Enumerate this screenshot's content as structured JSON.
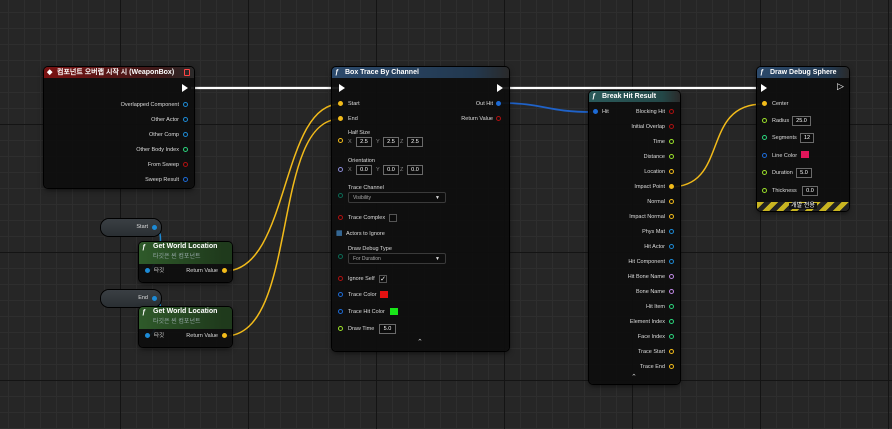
{
  "wire_colors": {
    "exec": "#ffffff",
    "struct": "#1d6bd6",
    "vector": "#f2bb1a",
    "object": "#1d8bd6"
  },
  "event_node": {
    "title": "컴포넌트 오버랩 시작 시 (WeaponBox)",
    "pins": [
      "Overlapped Component",
      "Other Actor",
      "Other Comp",
      "Other Body Index",
      "From Sweep",
      "Sweep Result"
    ]
  },
  "var_start": {
    "label": "Start"
  },
  "var_end": {
    "label": "End"
  },
  "gwl1": {
    "title": "Get World Location",
    "subtitle": "타깃은 씬 컴포넌트",
    "target": "타깃",
    "return": "Return Value"
  },
  "gwl2": {
    "title": "Get World Location",
    "subtitle": "타깃은 씬 컴포넌트",
    "target": "타깃",
    "return": "Return Value"
  },
  "box_trace": {
    "title": "Box Trace By Channel",
    "start": "Start",
    "end": "End",
    "out_hit": "Out Hit",
    "return_value": "Return Value",
    "half_size_label": "Half Size",
    "half_size": {
      "x": "2.5",
      "y": "2.5",
      "z": "2.5"
    },
    "orientation_label": "Orientation",
    "orientation": {
      "x": "0.0",
      "y": "0.0",
      "z": "0.0"
    },
    "axis_x": "X",
    "axis_y": "Y",
    "axis_z": "Z",
    "trace_channel_label": "Trace Channel",
    "trace_channel": "Visibility",
    "trace_complex": "Trace Complex",
    "actors_to_ignore": "Actors to Ignore",
    "draw_debug_type_label": "Draw Debug Type",
    "draw_debug_type": "For Duration",
    "ignore_self": "Ignore Self",
    "ignore_self_value": "✓",
    "trace_color": "Trace Color",
    "trace_color_value": "#e31111",
    "trace_hit_color": "Trace Hit Color",
    "trace_hit_color_value": "#19e619",
    "draw_time": "Draw Time",
    "draw_time_value": "5.0"
  },
  "break_hit": {
    "title": "Break Hit Result",
    "hit": "Hit",
    "pins": [
      "Blocking Hit",
      "Initial Overlap",
      "Time",
      "Distance",
      "Location",
      "Impact Point",
      "Normal",
      "Impact Normal",
      "Phys Mat",
      "Hit Actor",
      "Hit Component",
      "Hit Bone Name",
      "Bone Name",
      "Hit Item",
      "Element Index",
      "Face Index",
      "Trace Start",
      "Trace End"
    ]
  },
  "debug_sphere": {
    "title": "Draw Debug Sphere",
    "center": "Center",
    "radius_label": "Radius",
    "radius": "25.0",
    "segments_label": "Segments",
    "segments": "12",
    "line_color_label": "Line Color",
    "line_color": "#e0155a",
    "duration_label": "Duration",
    "duration": "5.0",
    "thickness_label": "Thickness",
    "thickness": "0.0",
    "footer": "개발 전용"
  }
}
